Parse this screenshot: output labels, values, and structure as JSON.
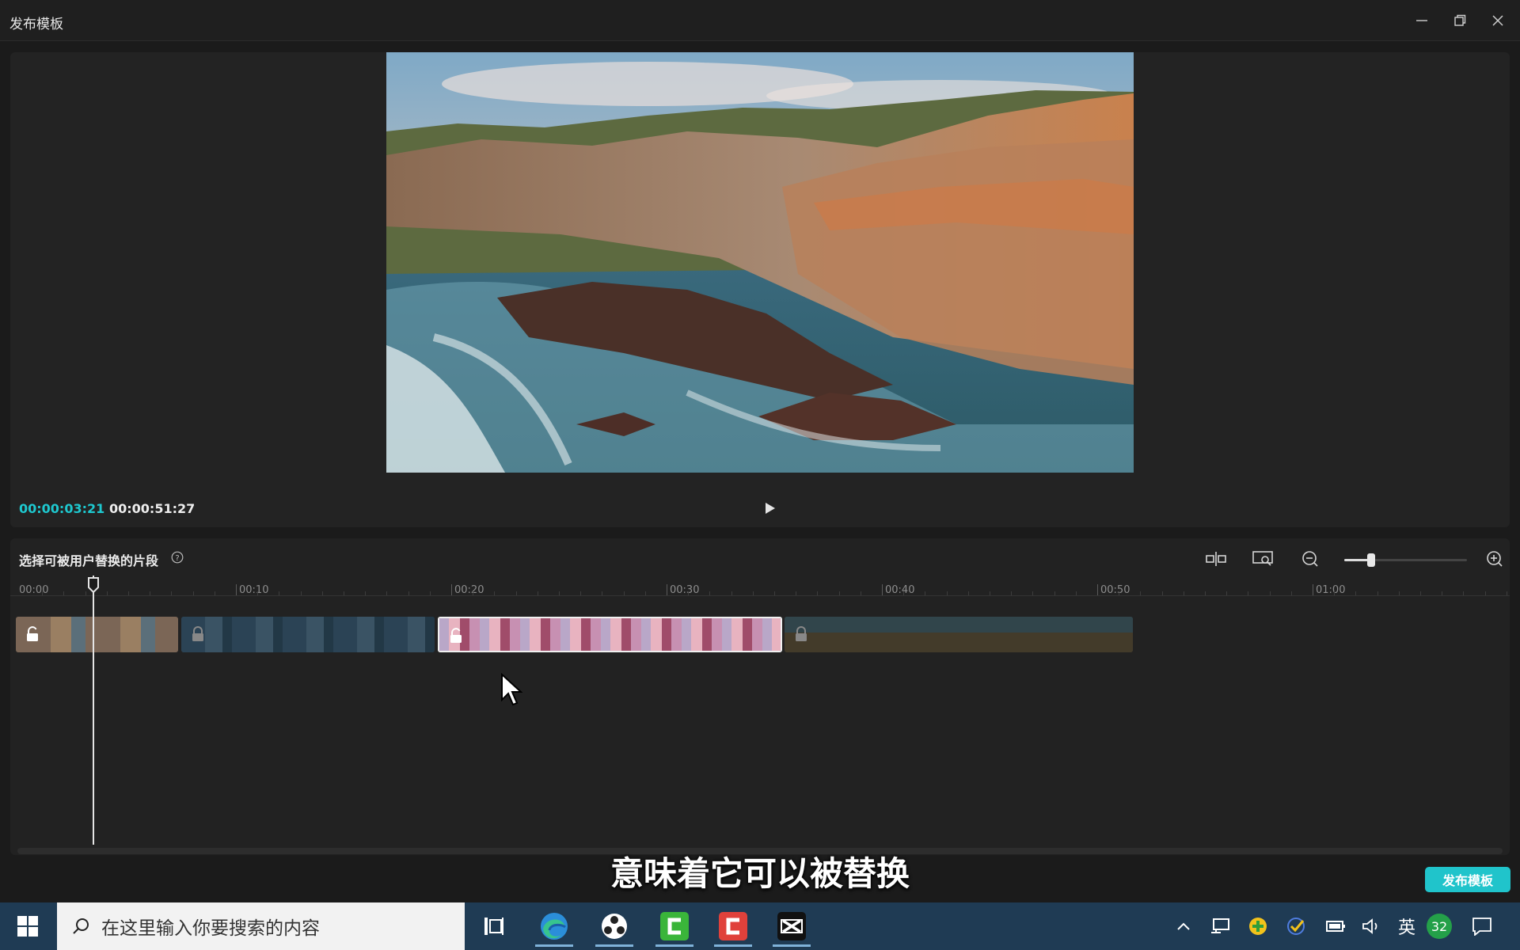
{
  "window": {
    "title": "发布模板"
  },
  "preview": {
    "current_time": "00:00:03:21",
    "total_time": "00:00:51:27"
  },
  "timeline": {
    "label": "选择可被用户替换的片段",
    "ruler": [
      "00:00",
      "00:10",
      "00:20",
      "00:30",
      "00:40",
      "00:50",
      "01:00"
    ],
    "zoom_level": 0.22,
    "playhead_time": "00:03",
    "clips": [
      {
        "name": "coastal-cliffs-clip",
        "state": "unlocked",
        "selected": false
      },
      {
        "name": "blue-water-clip",
        "state": "locked",
        "selected": false
      },
      {
        "name": "pink-sunset-clip",
        "state": "unlocked",
        "selected": true
      },
      {
        "name": "beach-figures-clip",
        "state": "locked",
        "selected": false
      }
    ]
  },
  "subtitle": "意味着它可以被替换",
  "publish_button": "发布模板",
  "taskbar": {
    "search_placeholder": "在这里输入你要搜索的内容",
    "apps": [
      "task-view-icon",
      "edge-icon",
      "davinci-icon",
      "camtasia-green-icon",
      "camtasia-red-icon",
      "capcut-icon"
    ],
    "tray_lang": "英",
    "tray_badge": "32"
  },
  "colors": {
    "accent": "#20c4cb",
    "time_current": "#1ec8cf",
    "taskbar": "#1f3b54"
  }
}
